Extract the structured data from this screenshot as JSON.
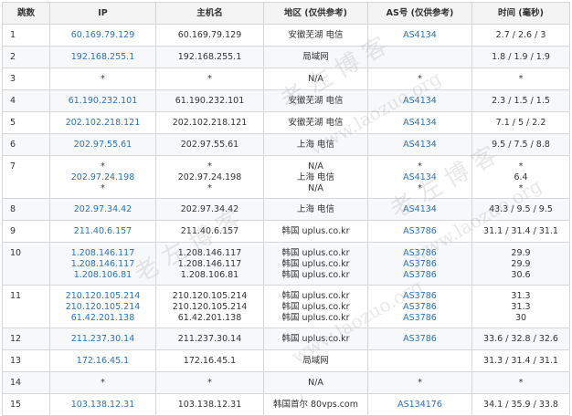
{
  "headers": [
    "跳数",
    "IP",
    "主机名",
    "地区 (仅供参考)",
    "AS号 (仅供参考)",
    "时间 (毫秒)"
  ],
  "rows": [
    {
      "hop": "1",
      "ip": [
        "60.169.79.129"
      ],
      "host": [
        "60.169.79.129"
      ],
      "region": [
        "安徽芜湖 电信"
      ],
      "as": [
        "AS4134"
      ],
      "time": [
        "2.7 / 2.6 / 3"
      ]
    },
    {
      "hop": "2",
      "ip": [
        "192.168.255.1"
      ],
      "host": [
        "192.168.255.1"
      ],
      "region": [
        "局域网"
      ],
      "as": [
        ""
      ],
      "time": [
        "1.8 / 1.9 / 1.9"
      ]
    },
    {
      "hop": "3",
      "ip": [
        "*"
      ],
      "host": [
        "*"
      ],
      "region": [
        "N/A"
      ],
      "as": [
        "*"
      ],
      "time": [
        "*"
      ]
    },
    {
      "hop": "4",
      "ip": [
        "61.190.232.101"
      ],
      "host": [
        "61.190.232.101"
      ],
      "region": [
        "安徽芜湖 电信"
      ],
      "as": [
        "AS4134"
      ],
      "time": [
        "2.3 / 1.5 / 1.5"
      ]
    },
    {
      "hop": "5",
      "ip": [
        "202.102.218.121"
      ],
      "host": [
        "202.102.218.121"
      ],
      "region": [
        "安徽芜湖 电信"
      ],
      "as": [
        "AS4134"
      ],
      "time": [
        "7.1 / 5 / 2.2"
      ]
    },
    {
      "hop": "6",
      "ip": [
        "202.97.55.61"
      ],
      "host": [
        "202.97.55.61"
      ],
      "region": [
        "上海 电信"
      ],
      "as": [
        "AS4134"
      ],
      "time": [
        "9.5 / 7.5 / 8.8"
      ]
    },
    {
      "hop": "7",
      "ip": [
        "*",
        "202.97.24.198",
        "*"
      ],
      "host": [
        "*",
        "202.97.24.198",
        "*"
      ],
      "region": [
        "N/A",
        "上海 电信",
        "N/A"
      ],
      "as": [
        "*",
        "AS4134",
        "*"
      ],
      "time": [
        "*",
        "6.4",
        "*"
      ]
    },
    {
      "hop": "8",
      "ip": [
        "202.97.34.42"
      ],
      "host": [
        "202.97.34.42"
      ],
      "region": [
        "上海 电信"
      ],
      "as": [
        "AS4134"
      ],
      "time": [
        "43.3 / 9.5 / 9.5"
      ]
    },
    {
      "hop": "9",
      "ip": [
        "211.40.6.157"
      ],
      "host": [
        "211.40.6.157"
      ],
      "region": [
        "韩国 uplus.co.kr"
      ],
      "as": [
        "AS3786"
      ],
      "time": [
        "31.1 / 31.4 / 31.1"
      ]
    },
    {
      "hop": "10",
      "ip": [
        "1.208.146.117",
        "1.208.146.117",
        "1.208.106.81"
      ],
      "host": [
        "1.208.146.117",
        "1.208.146.117",
        "1.208.106.81"
      ],
      "region": [
        "韩国 uplus.co.kr",
        "韩国 uplus.co.kr",
        "韩国 uplus.co.kr"
      ],
      "as": [
        "AS3786",
        "AS3786",
        "AS3786"
      ],
      "time": [
        "29.9",
        "29.9",
        "30.6"
      ]
    },
    {
      "hop": "11",
      "ip": [
        "210.120.105.214",
        "210.120.105.214",
        "61.42.201.138"
      ],
      "host": [
        "210.120.105.214",
        "210.120.105.214",
        "61.42.201.138"
      ],
      "region": [
        "韩国 uplus.co.kr",
        "韩国 uplus.co.kr",
        "韩国 uplus.co.kr"
      ],
      "as": [
        "AS3786",
        "AS3786",
        "AS3786"
      ],
      "time": [
        "31.3",
        "31.3",
        "30"
      ]
    },
    {
      "hop": "12",
      "ip": [
        "211.237.30.14"
      ],
      "host": [
        "211.237.30.14"
      ],
      "region": [
        "韩国 uplus.co.kr"
      ],
      "as": [
        "AS3786"
      ],
      "time": [
        "33.6 / 32.8 / 32.6"
      ]
    },
    {
      "hop": "13",
      "ip": [
        "172.16.45.1"
      ],
      "host": [
        "172.16.45.1"
      ],
      "region": [
        "局域网"
      ],
      "as": [
        ""
      ],
      "time": [
        "31.3 / 31.4 / 31.1"
      ]
    },
    {
      "hop": "14",
      "ip": [
        "*"
      ],
      "host": [
        "*"
      ],
      "region": [
        "N/A"
      ],
      "as": [
        "*"
      ],
      "time": [
        "*"
      ]
    },
    {
      "hop": "15",
      "ip": [
        "103.138.12.31"
      ],
      "host": [
        "103.138.12.31"
      ],
      "region": [
        "韩国首尔 80vps.com"
      ],
      "as": [
        "AS134176"
      ],
      "time": [
        "34.1 / 35.9 / 33.8"
      ]
    }
  ],
  "watermarks": [
    "老 左 博 客",
    "www.laozuo.org",
    "老 左 博 客",
    "www.laozuo.org",
    "老 左 博 客",
    "www.laozuo.org"
  ],
  "colors": {
    "link": "#2b72b8",
    "header_bg": "#f3f3f3",
    "border": "#d6d6d6"
  }
}
